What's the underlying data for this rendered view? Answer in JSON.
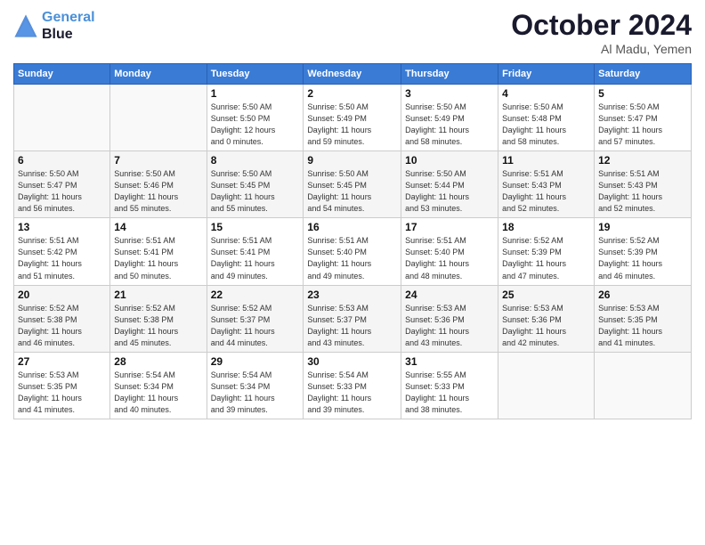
{
  "header": {
    "logo_line1": "General",
    "logo_line2": "Blue",
    "month": "October 2024",
    "location": "Al Madu, Yemen"
  },
  "columns": [
    "Sunday",
    "Monday",
    "Tuesday",
    "Wednesday",
    "Thursday",
    "Friday",
    "Saturday"
  ],
  "weeks": [
    [
      {
        "day": "",
        "info": ""
      },
      {
        "day": "",
        "info": ""
      },
      {
        "day": "1",
        "info": "Sunrise: 5:50 AM\nSunset: 5:50 PM\nDaylight: 12 hours\nand 0 minutes."
      },
      {
        "day": "2",
        "info": "Sunrise: 5:50 AM\nSunset: 5:49 PM\nDaylight: 11 hours\nand 59 minutes."
      },
      {
        "day": "3",
        "info": "Sunrise: 5:50 AM\nSunset: 5:49 PM\nDaylight: 11 hours\nand 58 minutes."
      },
      {
        "day": "4",
        "info": "Sunrise: 5:50 AM\nSunset: 5:48 PM\nDaylight: 11 hours\nand 58 minutes."
      },
      {
        "day": "5",
        "info": "Sunrise: 5:50 AM\nSunset: 5:47 PM\nDaylight: 11 hours\nand 57 minutes."
      }
    ],
    [
      {
        "day": "6",
        "info": "Sunrise: 5:50 AM\nSunset: 5:47 PM\nDaylight: 11 hours\nand 56 minutes."
      },
      {
        "day": "7",
        "info": "Sunrise: 5:50 AM\nSunset: 5:46 PM\nDaylight: 11 hours\nand 55 minutes."
      },
      {
        "day": "8",
        "info": "Sunrise: 5:50 AM\nSunset: 5:45 PM\nDaylight: 11 hours\nand 55 minutes."
      },
      {
        "day": "9",
        "info": "Sunrise: 5:50 AM\nSunset: 5:45 PM\nDaylight: 11 hours\nand 54 minutes."
      },
      {
        "day": "10",
        "info": "Sunrise: 5:50 AM\nSunset: 5:44 PM\nDaylight: 11 hours\nand 53 minutes."
      },
      {
        "day": "11",
        "info": "Sunrise: 5:51 AM\nSunset: 5:43 PM\nDaylight: 11 hours\nand 52 minutes."
      },
      {
        "day": "12",
        "info": "Sunrise: 5:51 AM\nSunset: 5:43 PM\nDaylight: 11 hours\nand 52 minutes."
      }
    ],
    [
      {
        "day": "13",
        "info": "Sunrise: 5:51 AM\nSunset: 5:42 PM\nDaylight: 11 hours\nand 51 minutes."
      },
      {
        "day": "14",
        "info": "Sunrise: 5:51 AM\nSunset: 5:41 PM\nDaylight: 11 hours\nand 50 minutes."
      },
      {
        "day": "15",
        "info": "Sunrise: 5:51 AM\nSunset: 5:41 PM\nDaylight: 11 hours\nand 49 minutes."
      },
      {
        "day": "16",
        "info": "Sunrise: 5:51 AM\nSunset: 5:40 PM\nDaylight: 11 hours\nand 49 minutes."
      },
      {
        "day": "17",
        "info": "Sunrise: 5:51 AM\nSunset: 5:40 PM\nDaylight: 11 hours\nand 48 minutes."
      },
      {
        "day": "18",
        "info": "Sunrise: 5:52 AM\nSunset: 5:39 PM\nDaylight: 11 hours\nand 47 minutes."
      },
      {
        "day": "19",
        "info": "Sunrise: 5:52 AM\nSunset: 5:39 PM\nDaylight: 11 hours\nand 46 minutes."
      }
    ],
    [
      {
        "day": "20",
        "info": "Sunrise: 5:52 AM\nSunset: 5:38 PM\nDaylight: 11 hours\nand 46 minutes."
      },
      {
        "day": "21",
        "info": "Sunrise: 5:52 AM\nSunset: 5:38 PM\nDaylight: 11 hours\nand 45 minutes."
      },
      {
        "day": "22",
        "info": "Sunrise: 5:52 AM\nSunset: 5:37 PM\nDaylight: 11 hours\nand 44 minutes."
      },
      {
        "day": "23",
        "info": "Sunrise: 5:53 AM\nSunset: 5:37 PM\nDaylight: 11 hours\nand 43 minutes."
      },
      {
        "day": "24",
        "info": "Sunrise: 5:53 AM\nSunset: 5:36 PM\nDaylight: 11 hours\nand 43 minutes."
      },
      {
        "day": "25",
        "info": "Sunrise: 5:53 AM\nSunset: 5:36 PM\nDaylight: 11 hours\nand 42 minutes."
      },
      {
        "day": "26",
        "info": "Sunrise: 5:53 AM\nSunset: 5:35 PM\nDaylight: 11 hours\nand 41 minutes."
      }
    ],
    [
      {
        "day": "27",
        "info": "Sunrise: 5:53 AM\nSunset: 5:35 PM\nDaylight: 11 hours\nand 41 minutes."
      },
      {
        "day": "28",
        "info": "Sunrise: 5:54 AM\nSunset: 5:34 PM\nDaylight: 11 hours\nand 40 minutes."
      },
      {
        "day": "29",
        "info": "Sunrise: 5:54 AM\nSunset: 5:34 PM\nDaylight: 11 hours\nand 39 minutes."
      },
      {
        "day": "30",
        "info": "Sunrise: 5:54 AM\nSunset: 5:33 PM\nDaylight: 11 hours\nand 39 minutes."
      },
      {
        "day": "31",
        "info": "Sunrise: 5:55 AM\nSunset: 5:33 PM\nDaylight: 11 hours\nand 38 minutes."
      },
      {
        "day": "",
        "info": ""
      },
      {
        "day": "",
        "info": ""
      }
    ]
  ]
}
